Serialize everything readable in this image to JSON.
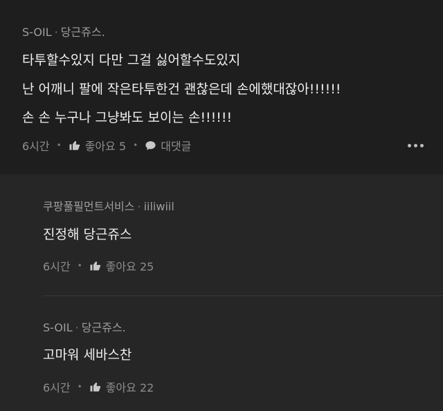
{
  "main_comment": {
    "author": "S-OIL",
    "reply_to": "당근쥬스.",
    "lines": [
      "타투할수있지 다만 그걸 싫어할수도있지",
      "난 어깨니 팔에 작은타투한건 괜찮은데 손에했대잖아!!!!!!",
      "손 손 누구나 그냥봐도 보이는 손!!!!!!"
    ],
    "time": "6시간",
    "like_label": "좋아요 5",
    "reply_label": "대댓글"
  },
  "replies": [
    {
      "author": "쿠팡풀필먼트서비스",
      "reply_to": "iiliwiil",
      "text": "진정해 당근쥬스",
      "time": "6시간",
      "like_label": "좋아요 25"
    },
    {
      "author": "S-OIL",
      "reply_to": "당근쥬스.",
      "text": "고마워 세바스찬",
      "time": "6시간",
      "like_label": "좋아요 22"
    }
  ],
  "icons": {
    "like": "thumbs-up-icon",
    "reply": "speech-bubble-icon",
    "more": "more-dots-icon"
  },
  "colors": {
    "background": "#1e1e1e",
    "reply_background": "#262626",
    "text": "#f0f0f0",
    "muted": "#9e9e9e"
  }
}
